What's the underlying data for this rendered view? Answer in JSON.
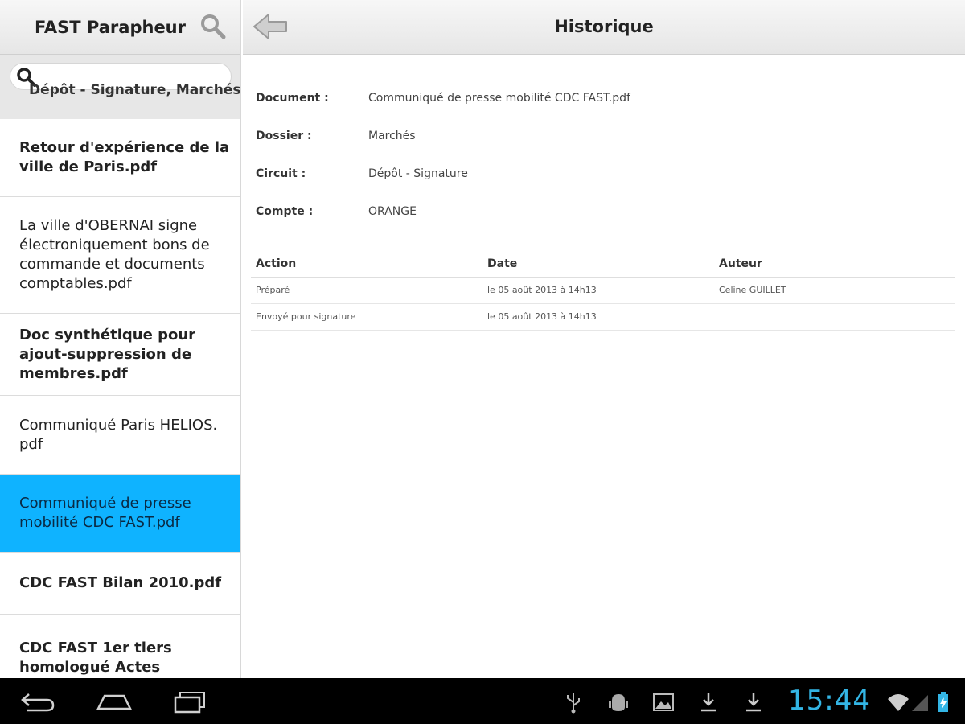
{
  "app": {
    "title": "FAST Parapheur"
  },
  "search": {
    "value": "",
    "placeholder": ""
  },
  "list": {
    "cut_top_item": "Dépôt - Signature, Marchés",
    "items": [
      {
        "label": "Retour d'expérience de la ville de Paris.pdf",
        "bold": true
      },
      {
        "label": "La ville d'OBERNAI signe électroniquement bons de commande et documents comptables.pdf",
        "bold": false
      },
      {
        "label": "Doc synthétique pour ajout-suppression de membres.pdf",
        "bold": true
      },
      {
        "label": "Communiqué Paris HELIOS. pdf",
        "bold": false
      },
      {
        "label": "Communiqué de presse mobilité CDC FAST.pdf",
        "bold": false,
        "selected": true
      },
      {
        "label": "CDC FAST Bilan 2010.pdf",
        "bold": true
      },
      {
        "label": "CDC FAST 1er tiers homologué Actes",
        "bold": true
      }
    ]
  },
  "detail": {
    "title": "Historique",
    "fields": [
      {
        "label": "Document :",
        "value": "Communiqué de presse mobilité CDC FAST.pdf"
      },
      {
        "label": "Dossier :",
        "value": "Marchés"
      },
      {
        "label": "Circuit :",
        "value": "Dépôt - Signature"
      },
      {
        "label": "Compte :",
        "value": "ORANGE"
      }
    ],
    "history": {
      "headers": [
        "Action",
        "Date",
        "Auteur"
      ],
      "rows": [
        [
          "Préparé",
          "le 05 août 2013 à 14h13",
          "Celine GUILLET"
        ],
        [
          "Envoyé pour signature",
          "le 05 août 2013 à 14h13",
          ""
        ]
      ]
    }
  },
  "system": {
    "clock": "15:44"
  },
  "colors": {
    "selected": "#0fb3ff",
    "clock": "#33b5e5"
  }
}
